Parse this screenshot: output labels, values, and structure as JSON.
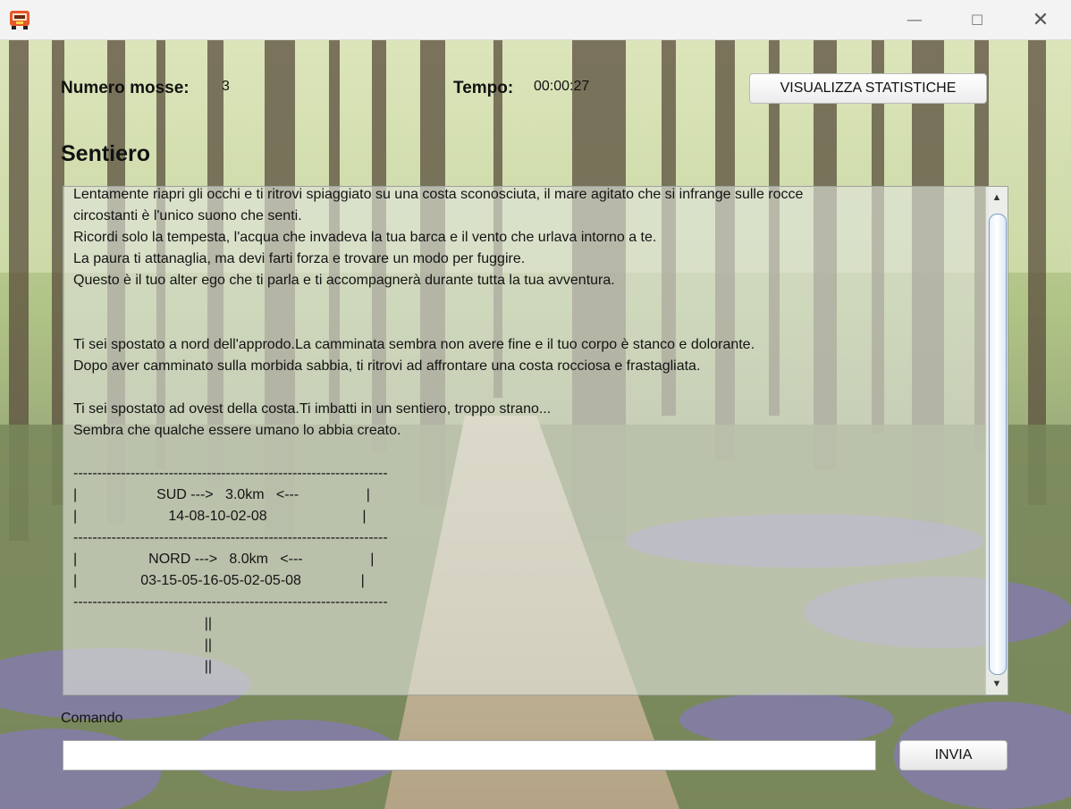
{
  "window": {
    "icon": "game-app-icon",
    "controls": {
      "minimize": "—",
      "maximize": "☐",
      "close": "✕"
    }
  },
  "header": {
    "moves_label": "Numero mosse:",
    "moves_value": "3",
    "time_label": "Tempo:",
    "time_value": "00:00:27",
    "stats_button": "VISUALIZZA STATISTICHE"
  },
  "room": {
    "title": "Sentiero"
  },
  "log": {
    "lines": [
      "Lentamente riapri gli occhi e ti ritrovi spiaggiato su una costa sconosciuta, il mare agitato che si infrange sulle rocce",
      "circostanti è l'unico suono che senti.",
      "Ricordi solo la tempesta, l'acqua che invadeva la tua barca e il vento che urlava intorno a te.",
      "La paura ti attanaglia, ma devi farti forza e trovare un modo per fuggire.",
      "Questo è il tuo alter ego che ti parla e ti accompagnerà durante tutta la tua avventura.",
      "",
      "",
      "Ti sei spostato a nord dell'approdo.La camminata sembra non avere fine e il tuo corpo è stanco e dolorante.",
      "Dopo aver camminato sulla morbida sabbia, ti ritrovi ad affrontare una costa rocciosa e frastagliata.",
      "",
      "Ti sei spostato ad ovest della costa.Ti imbatti in un sentiero, troppo strano...",
      "Sembra che qualche essere umano lo abbia creato.",
      "",
      "------------------------------------------------------------------",
      "|                    SUD --->   3.0km   <---                 |",
      "|                       14-08-10-02-08                        |",
      "------------------------------------------------------------------",
      "|                  NORD --->   8.0km   <---                 |",
      "|                03-15-05-16-05-02-05-08               |",
      "------------------------------------------------------------------",
      "                                 ||",
      "                                 ||",
      "                                 ||"
    ]
  },
  "scrollbar": {
    "up_arrow": "▲",
    "down_arrow": "▼"
  },
  "command": {
    "label": "Comando",
    "value": "",
    "send_button": "INVIA"
  }
}
